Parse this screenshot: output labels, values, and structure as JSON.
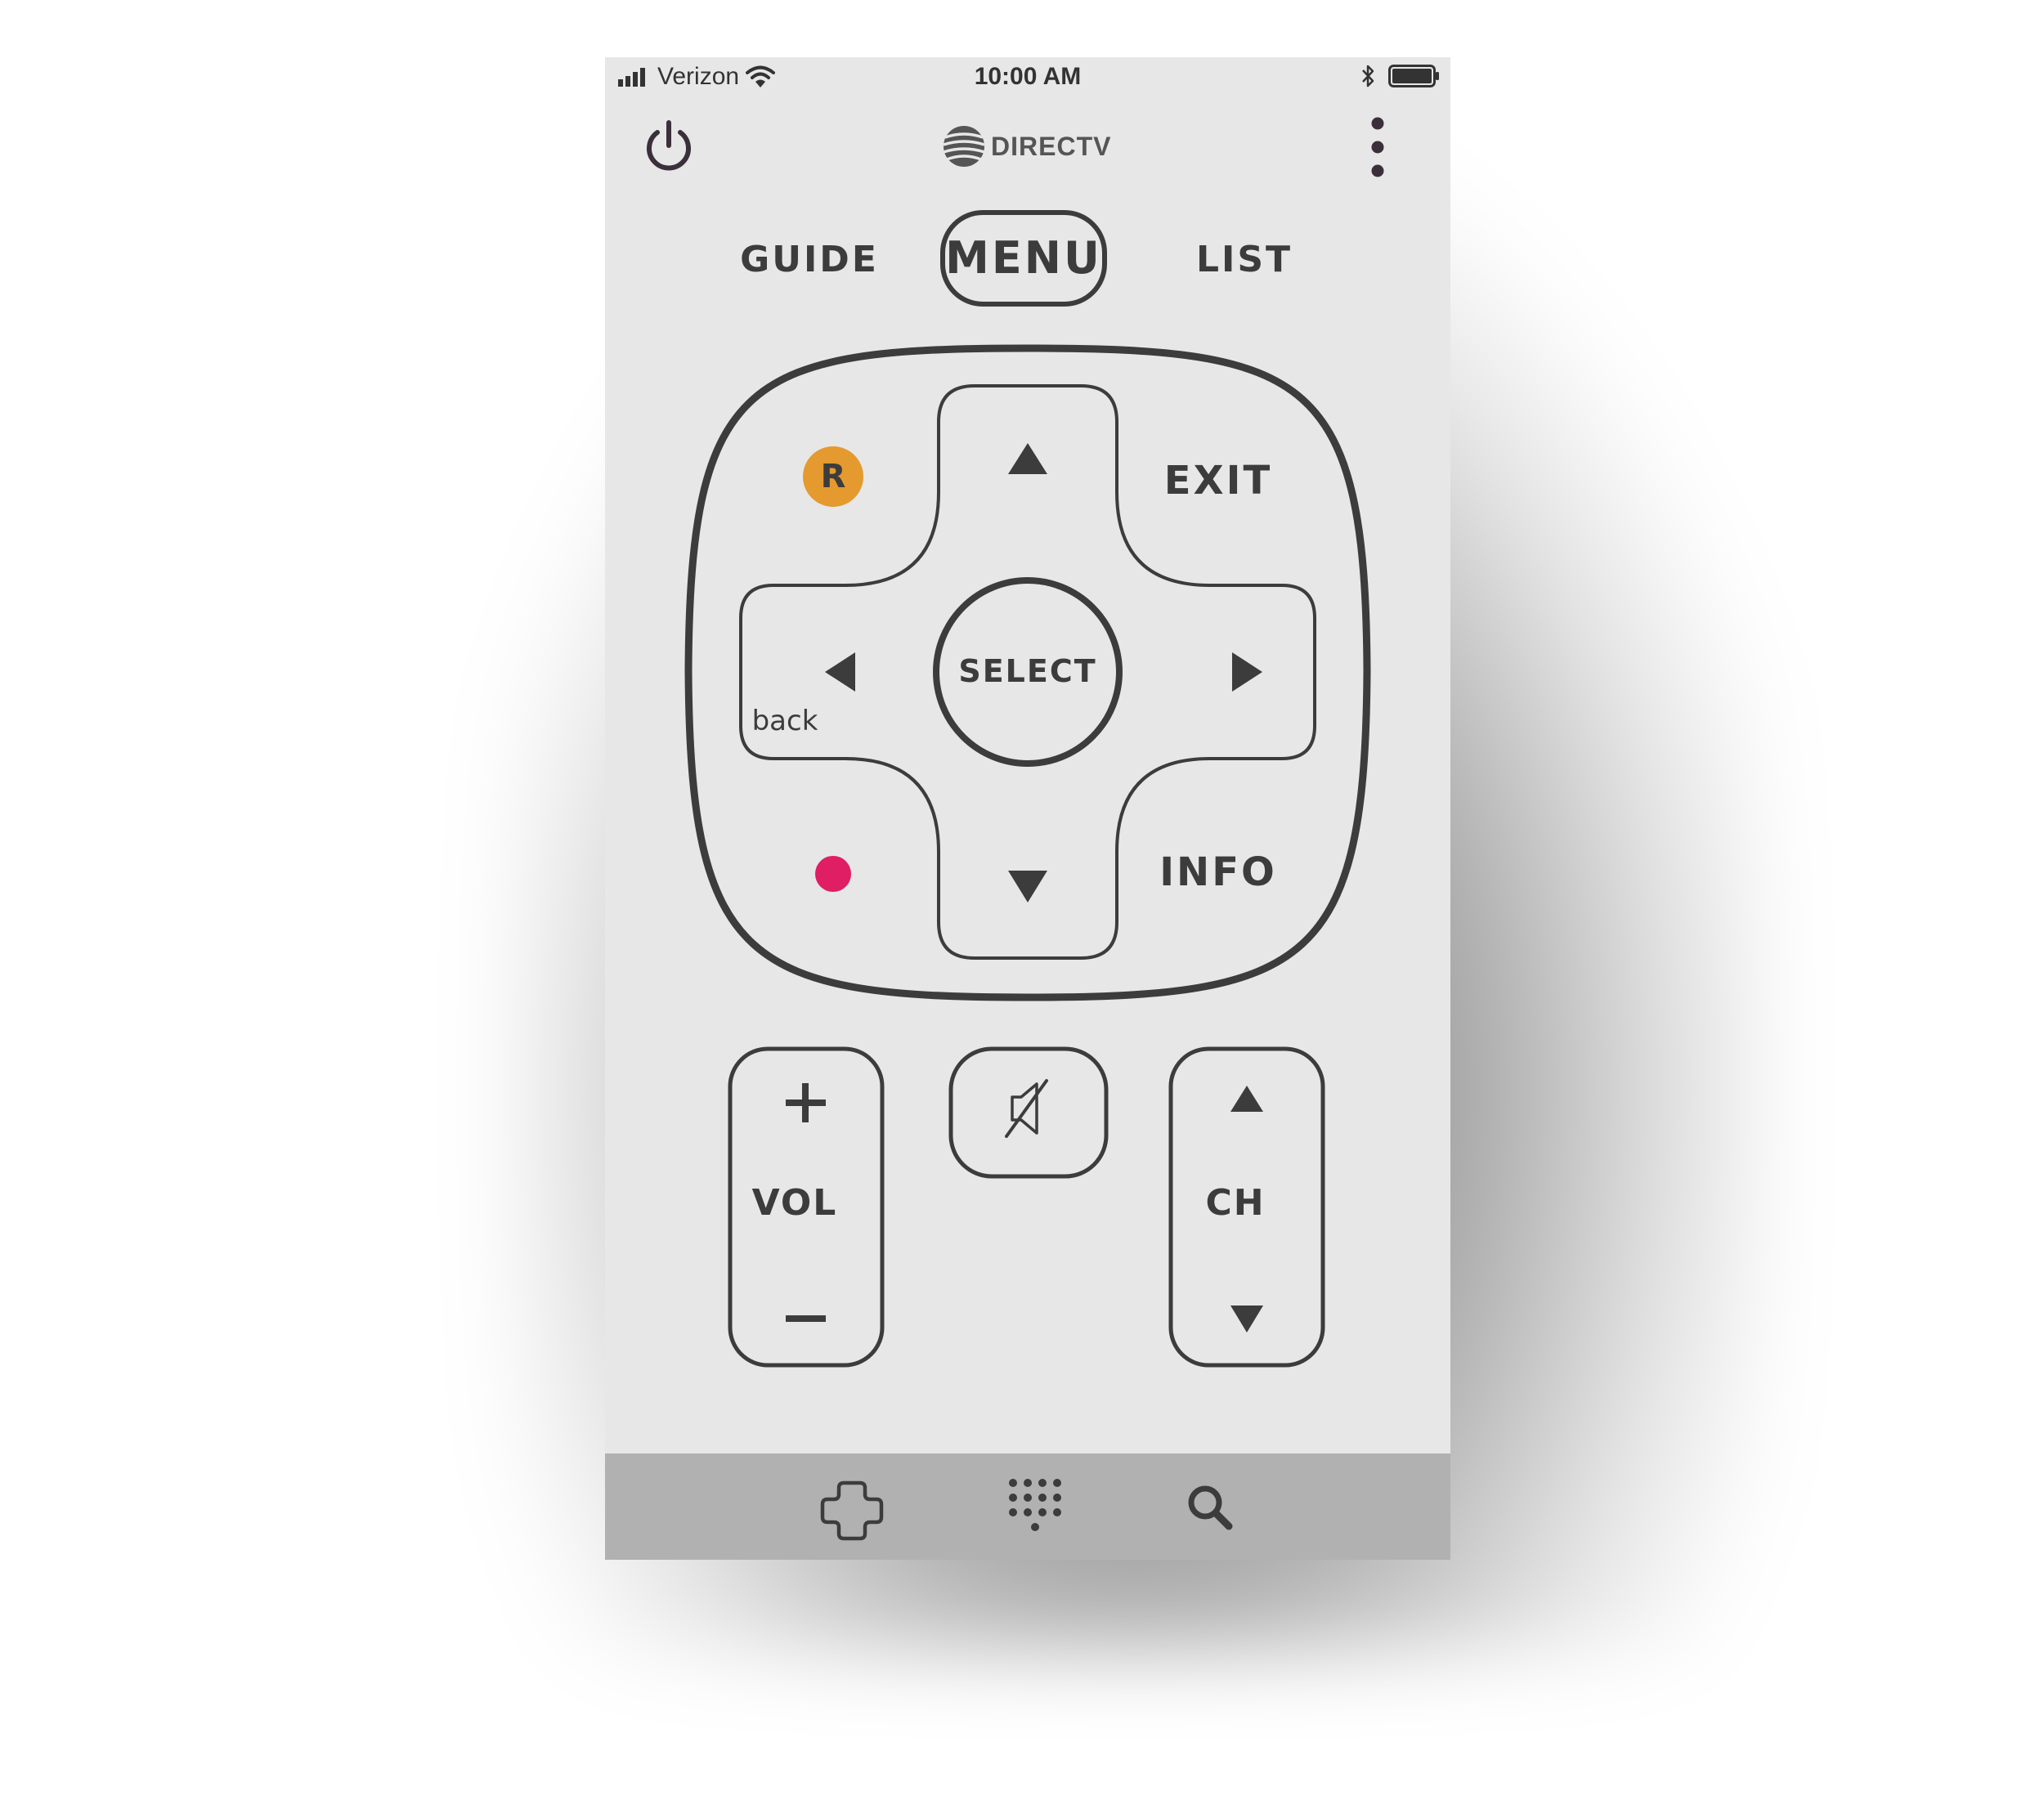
{
  "status_bar": {
    "carrier": "Verizon",
    "time": "10:00 AM",
    "icons": [
      "signal-bars-icon",
      "wifi-icon",
      "bluetooth-icon",
      "battery-icon"
    ]
  },
  "header": {
    "brand": "DIRECTV",
    "icons": [
      "power-icon",
      "att-globe-logo",
      "more-vertical-icon"
    ]
  },
  "top_buttons": {
    "guide": "GUIDE",
    "menu": "MENU",
    "list": "LIST"
  },
  "dpad": {
    "select": "SELECT",
    "exit": "EXIT",
    "info": "INFO",
    "back": "back",
    "replay": "R",
    "icons": [
      "arrow-up-icon",
      "arrow-down-icon",
      "arrow-left-icon",
      "arrow-right-icon",
      "record-icon"
    ]
  },
  "controls": {
    "volume": "VOL",
    "channel": "CH",
    "icons": [
      "plus-icon",
      "minus-icon",
      "mute-icon",
      "channel-up-icon",
      "channel-down-icon"
    ]
  },
  "bottom_nav": {
    "icons": [
      "dpad-icon",
      "keypad-icon",
      "search-icon"
    ]
  },
  "colors": {
    "screen_bg": "#e7e7e7",
    "outline": "#3c3c3c",
    "replay_orange": "#e49a2e",
    "record_pink": "#df1e63",
    "nav_bar": "#b1b1b1"
  }
}
